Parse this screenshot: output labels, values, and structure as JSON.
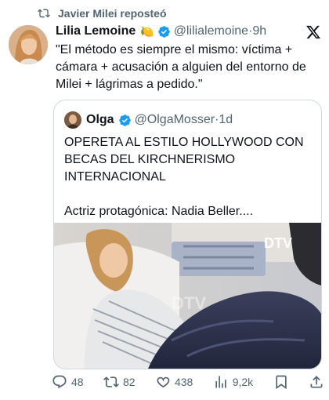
{
  "repost": {
    "label": "Javier Milei reposteó"
  },
  "tweet": {
    "name": "Lilia Lemoine",
    "emoji": "🍋",
    "handle": "@lilialemoine",
    "separator": "·",
    "time": "9h",
    "text": "\"El método es siempre el mismo: víctima + cámara + acusación a alguien del entorno de Milei + lágrimas a pedido.\""
  },
  "quote": {
    "name": "Olga",
    "handle": "@OlgaMosser",
    "separator": "·",
    "time": "1d",
    "line1": "OPERETA AL ESTILO HOLLYWOOD CON BECAS DEL KIRCHNERISMO INTERNACIONAL",
    "line2": "Actriz protagónica: Nadia Beller....",
    "media_watermark": "DTV"
  },
  "actions": {
    "replies": "48",
    "reposts": "82",
    "likes": "438",
    "views": "9,2k"
  },
  "icons": {
    "repost": "repost-icon",
    "verified": "verified-badge-icon",
    "close": "x-logo-icon",
    "reply": "reply-icon",
    "like": "heart-icon",
    "views": "views-chart-icon",
    "bookmark": "bookmark-icon",
    "share": "share-icon"
  },
  "colors": {
    "verified": "#1d9bf0",
    "text": "#0f1419",
    "muted": "#536471",
    "border": "#cfd9de"
  }
}
